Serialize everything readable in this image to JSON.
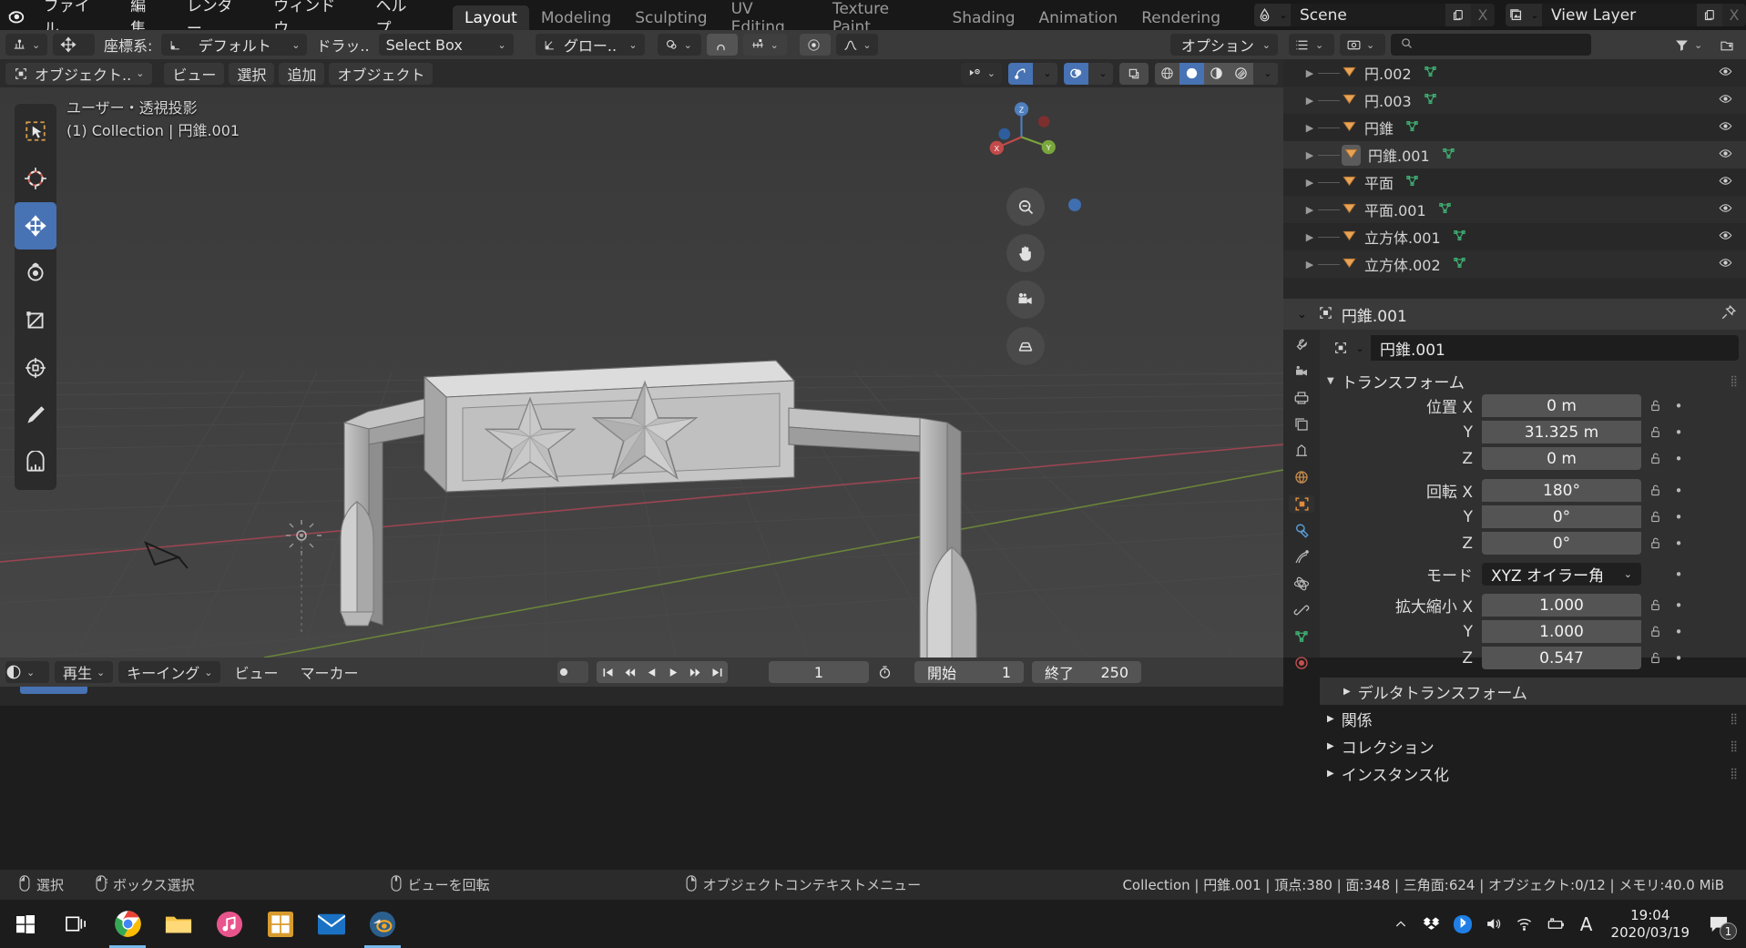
{
  "topbar": {
    "logo_icon": "blender-logo",
    "menus": [
      "ファイル",
      "編集",
      "レンダー",
      "ウィンドウ",
      "ヘルプ"
    ],
    "workspaces": [
      {
        "label": "Layout",
        "active": true
      },
      {
        "label": "Modeling",
        "active": false
      },
      {
        "label": "Sculpting",
        "active": false
      },
      {
        "label": "UV Editing",
        "active": false
      },
      {
        "label": "Texture Paint",
        "active": false
      },
      {
        "label": "Shading",
        "active": false
      },
      {
        "label": "Animation",
        "active": false
      },
      {
        "label": "Rendering",
        "active": false
      }
    ],
    "scene": {
      "name": "Scene",
      "icon": "scene-icon",
      "copy_icon": "new-scene-icon",
      "x_label": "X"
    },
    "view_layer": {
      "name": "View Layer",
      "icon": "view-layer-icon",
      "copy_icon": "new-layer-icon",
      "x_label": "X"
    }
  },
  "tool_header": {
    "editor_mode_icon": "editor-type-icon",
    "transform_icon": "move-tool-icon",
    "orientation_label": "座標系:",
    "orientation_value": "デフォルト",
    "drag_label": "ドラッ..",
    "drag_value": "Select Box",
    "snap_icon": "snap-icon",
    "snap_value": "グロー..",
    "proportional_icon": "proportional-edit-icon",
    "magnet_icon": "magnet-icon",
    "increment_icon": "snap-increment-icon",
    "falloff_icon": "falloff-icon",
    "options_label": "オプション"
  },
  "viewport_header": {
    "mode": "オブジェクト..",
    "menus": [
      "ビュー",
      "選択",
      "追加",
      "オブジェクト"
    ],
    "visibility_icon": "object-visibility-icon",
    "gizmo_icon": "gizmo-icon",
    "overlays_icon": "overlays-icon",
    "xray_icon": "xray-icon",
    "shading": [
      {
        "icon": "wireframe-shading-icon",
        "active": false
      },
      {
        "icon": "solid-shading-icon",
        "active": true
      },
      {
        "icon": "material-preview-icon",
        "active": false
      },
      {
        "icon": "rendered-shading-icon",
        "active": false
      }
    ]
  },
  "viewport": {
    "info_line1": "ユーザー・透視投影",
    "info_line2": "(1) Collection | 円錐.001",
    "tools": [
      {
        "icon": "tweak-select-tool-icon",
        "active": false
      },
      {
        "icon": "cursor-tool-icon",
        "active": false
      },
      {
        "icon": "move-tool-icon",
        "active": true
      },
      {
        "icon": "rotate-tool-icon",
        "active": false
      },
      {
        "icon": "scale-tool-icon",
        "active": false
      },
      {
        "icon": "transform-tool-icon",
        "active": false
      },
      {
        "icon": "annotate-tool-icon",
        "active": false
      },
      {
        "icon": "measure-tool-icon",
        "active": false
      }
    ],
    "gizmo_axes": [
      "Z",
      "X",
      "Y"
    ],
    "nav_buttons": [
      "zoom-icon",
      "pan-hand-icon",
      "camera-view-icon",
      "toggle-perspective-icon"
    ]
  },
  "outliner": {
    "display_mode_icon": "outliner-display-icon",
    "filter_icon": "filter-icon",
    "search_placeholder": "",
    "items": [
      {
        "name": "円.002",
        "type_icon": "mesh-object-icon",
        "data_icon": "mesh-data-icon",
        "selected": false
      },
      {
        "name": "円.003",
        "type_icon": "mesh-object-icon",
        "data_icon": "mesh-data-icon",
        "selected": false
      },
      {
        "name": "円錐",
        "type_icon": "mesh-object-icon",
        "data_icon": "mesh-data-icon",
        "selected": false
      },
      {
        "name": "円錐.001",
        "type_icon": "mesh-object-icon",
        "data_icon": "mesh-data-icon",
        "selected": true
      },
      {
        "name": "平面",
        "type_icon": "mesh-object-icon",
        "data_icon": "mesh-data-icon",
        "selected": false
      },
      {
        "name": "平面.001",
        "type_icon": "mesh-object-icon",
        "data_icon": "mesh-data-icon",
        "selected": false
      },
      {
        "name": "立方体.001",
        "type_icon": "mesh-object-icon",
        "data_icon": "mesh-data-icon",
        "selected": false
      },
      {
        "name": "立方体.002",
        "type_icon": "mesh-object-icon",
        "data_icon": "mesh-data-icon",
        "selected": false
      }
    ]
  },
  "properties": {
    "breadcrumb_object": "円錐.001",
    "breadcrumb_icon": "object-properties-icon",
    "pin_icon": "pin-icon",
    "name_field": "円錐.001",
    "tabs": [
      {
        "icon": "tool-tab-icon",
        "active": false
      },
      {
        "icon": "render-tab-icon",
        "active": false
      },
      {
        "icon": "output-tab-icon",
        "active": false
      },
      {
        "icon": "view-layer-tab-icon",
        "active": false
      },
      {
        "icon": "scene-tab-icon",
        "active": false
      },
      {
        "icon": "world-tab-icon",
        "active": false
      },
      {
        "icon": "object-tab-icon",
        "active": true
      },
      {
        "icon": "modifier-tab-icon",
        "active": false
      },
      {
        "icon": "particles-tab-icon",
        "active": false
      },
      {
        "icon": "physics-tab-icon",
        "active": false
      },
      {
        "icon": "constraints-tab-icon",
        "active": false
      },
      {
        "icon": "object-data-tab-icon",
        "active": false
      },
      {
        "icon": "material-tab-icon",
        "active": false
      }
    ],
    "transform_panel": "トランスフォーム",
    "rows": [
      {
        "label": "位置 X",
        "value": "0 m"
      },
      {
        "label": "Y",
        "value": "31.325 m"
      },
      {
        "label": "Z",
        "value": "0 m"
      },
      {
        "label": "回転 X",
        "value": "180°"
      },
      {
        "label": "Y",
        "value": "0°"
      },
      {
        "label": "Z",
        "value": "0°"
      },
      {
        "label": "モード",
        "value": "XYZ オイラー角"
      },
      {
        "label": "拡大縮小 X",
        "value": "1.000"
      },
      {
        "label": "Y",
        "value": "1.000"
      },
      {
        "label": "Z",
        "value": "0.547"
      }
    ],
    "subpanels": [
      "デルタトランスフォーム",
      "関係",
      "コレクション",
      "インスタンス化"
    ]
  },
  "timeline": {
    "editor_icon": "timeline-editor-icon",
    "menus": [
      "再生",
      "キーイング",
      "ビュー",
      "マーカー"
    ],
    "record_icon": "auto-keying-icon",
    "playback_icons": [
      "jump-start-icon",
      "prev-keyframe-icon",
      "play-reverse-icon",
      "play-icon",
      "next-keyframe-icon",
      "jump-end-icon"
    ],
    "current_frame": "1",
    "clock_icon": "use-preview-range-icon",
    "start_label": "開始",
    "start_value": "1",
    "end_label": "終了",
    "end_value": "250"
  },
  "status_bar": {
    "items": [
      {
        "icon": "mouse-left-icon",
        "label": "選択"
      },
      {
        "icon": "mouse-drag-icon",
        "label": "ボックス選択"
      },
      {
        "icon": "mouse-middle-icon",
        "label": "ビューを回転"
      },
      {
        "icon": "mouse-right-icon",
        "label": "オブジェクトコンテキストメニュー"
      }
    ],
    "stats": "Collection | 円錐.001 | 頂点:380 | 面:348 | 三角面:624 | オブジェクト:0/12 | メモリ:40.0 MiB"
  },
  "taskbar": {
    "apps": [
      {
        "icon": "windows-start-icon",
        "name": "start-button"
      },
      {
        "icon": "task-view-icon",
        "name": "task-view-button"
      },
      {
        "icon": "chrome-icon",
        "name": "chrome-app"
      },
      {
        "icon": "file-explorer-icon",
        "name": "explorer-app"
      },
      {
        "icon": "music-icon",
        "name": "music-app"
      },
      {
        "icon": "store-icon",
        "name": "store-app"
      },
      {
        "icon": "mail-icon",
        "name": "mail-app"
      },
      {
        "icon": "blender-taskbar-icon",
        "name": "blender-app"
      }
    ],
    "tray": [
      "show-hidden-icons-icon",
      "dropbox-icon",
      "bluetooth-icon",
      "volume-icon",
      "wifi-icon",
      "battery-icon",
      "ime-icon"
    ],
    "time": "19:04",
    "date": "2020/03/19",
    "notification_count": "1"
  },
  "colors": {
    "accent_blue": "#4772b3",
    "header_gray": "#3a3a3a",
    "panel_gray": "#303030",
    "outliner_gray": "#282828",
    "viewport_gray": "#3d3d3d",
    "mesh_orange": "#e8a355",
    "mesh_data_green": "#3fae72"
  }
}
